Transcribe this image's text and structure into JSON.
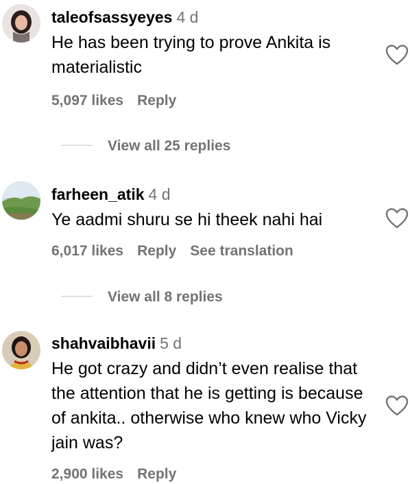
{
  "comments": [
    {
      "username": "taleofsassyeyes",
      "time": "4 d",
      "text": "He has been trying to prove Ankita is materialistic",
      "likes": "5,097 likes",
      "reply_label": "Reply",
      "view_replies": "View all 25 replies",
      "avatar": "woman-portrait-avatar"
    },
    {
      "username": "farheen_atik",
      "time": "4 d",
      "text": "Ye aadmi shuru se hi theek nahi hai",
      "likes": "6,017 likes",
      "reply_label": "Reply",
      "translation_label": "See translation",
      "view_replies": "View all 8 replies",
      "avatar": "landscape-avatar"
    },
    {
      "username": "shahvaibhavii",
      "time": "5 d",
      "text": "He got crazy and didn’t even realise that the attention that he is getting is because of ankita.. otherwise who knew who Vicky jain was?",
      "likes": "2,900 likes",
      "reply_label": "Reply",
      "avatar": "woman-yellow-avatar"
    }
  ],
  "icons": {
    "like": "heart-outline-icon"
  },
  "colors": {
    "secondary_text": "#737373",
    "primary_text": "#000000"
  }
}
